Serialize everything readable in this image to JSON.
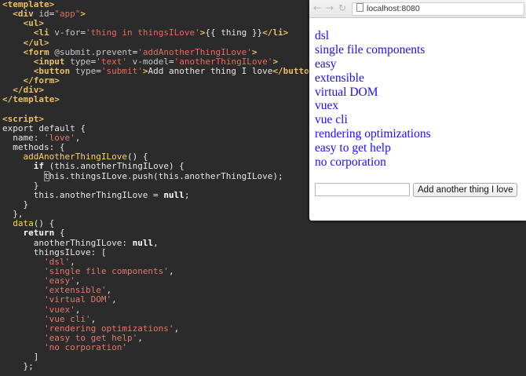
{
  "editor": {
    "lines": [
      [
        [
          "tag",
          "<template>"
        ]
      ],
      [
        [
          "plain",
          "  "
        ],
        [
          "tag",
          "<div "
        ],
        [
          "attr",
          "id"
        ],
        [
          "plain",
          "="
        ],
        [
          "str",
          "\"app\""
        ],
        [
          "tag",
          ">"
        ]
      ],
      [
        [
          "plain",
          "    "
        ],
        [
          "tag",
          "<ul>"
        ]
      ],
      [
        [
          "plain",
          "      "
        ],
        [
          "tag",
          "<li "
        ],
        [
          "attr",
          "v-for"
        ],
        [
          "plain",
          "="
        ],
        [
          "str",
          "'thing in thingsILove'"
        ],
        [
          "tag",
          ">"
        ],
        [
          "plain",
          "{{ thing }}"
        ],
        [
          "tag",
          "</li>"
        ]
      ],
      [
        [
          "plain",
          "    "
        ],
        [
          "tag",
          "</ul>"
        ]
      ],
      [
        [
          "plain",
          "    "
        ],
        [
          "tag",
          "<form "
        ],
        [
          "attr",
          "@submit.prevent"
        ],
        [
          "plain",
          "="
        ],
        [
          "str",
          "'addAnotherThingILove'"
        ],
        [
          "tag",
          ">"
        ]
      ],
      [
        [
          "plain",
          "      "
        ],
        [
          "tag",
          "<input "
        ],
        [
          "attr",
          "type"
        ],
        [
          "plain",
          "="
        ],
        [
          "str",
          "'text'"
        ],
        [
          "plain",
          " "
        ],
        [
          "attr",
          "v-model"
        ],
        [
          "plain",
          "="
        ],
        [
          "str",
          "'anotherThingILove'"
        ],
        [
          "tag",
          ">"
        ]
      ],
      [
        [
          "plain",
          "      "
        ],
        [
          "tag",
          "<button "
        ],
        [
          "attr",
          "type"
        ],
        [
          "plain",
          "="
        ],
        [
          "str",
          "'submit'"
        ],
        [
          "tag",
          ">"
        ],
        [
          "plain",
          "Add another thing I love"
        ],
        [
          "tag",
          "</button>"
        ]
      ],
      [
        [
          "plain",
          "    "
        ],
        [
          "tag",
          "</form>"
        ]
      ],
      [
        [
          "plain",
          "  "
        ],
        [
          "tag",
          "</div>"
        ]
      ],
      [
        [
          "tag",
          "</template>"
        ]
      ],
      [
        [
          "plain",
          ""
        ]
      ],
      [
        [
          "tag",
          "<script>"
        ]
      ],
      [
        [
          "plain",
          "export default {"
        ]
      ],
      [
        [
          "plain",
          "  name: "
        ],
        [
          "vstr",
          "'love'"
        ],
        [
          "plain",
          ","
        ]
      ],
      [
        [
          "plain",
          "  methods: {"
        ]
      ],
      [
        [
          "plain",
          "    "
        ],
        [
          "fn",
          "addAnotherThingILove"
        ],
        [
          "plain",
          "() {"
        ]
      ],
      [
        [
          "plain",
          "      "
        ],
        [
          "kw",
          "if"
        ],
        [
          "plain",
          " (this.anotherThingILove) {"
        ]
      ],
      [
        [
          "plain",
          "        "
        ],
        [
          "cursor",
          "t"
        ],
        [
          "plain",
          "his.thingsILove.push(this.anotherThingILove);"
        ]
      ],
      [
        [
          "plain",
          "      }"
        ]
      ],
      [
        [
          "plain",
          "      this.anotherThingILove = "
        ],
        [
          "kw",
          "null"
        ],
        [
          "plain",
          ";"
        ]
      ],
      [
        [
          "plain",
          "    }"
        ]
      ],
      [
        [
          "plain",
          "  },"
        ]
      ],
      [
        [
          "plain",
          "  "
        ],
        [
          "fn",
          "data"
        ],
        [
          "plain",
          "() {"
        ]
      ],
      [
        [
          "plain",
          "    "
        ],
        [
          "kw",
          "return"
        ],
        [
          "plain",
          " {"
        ]
      ],
      [
        [
          "plain",
          "      anotherThingILove: "
        ],
        [
          "kw",
          "null"
        ],
        [
          "plain",
          ","
        ]
      ],
      [
        [
          "plain",
          "      thingsILove: ["
        ]
      ],
      [
        [
          "plain",
          "        "
        ],
        [
          "vstr",
          "'dsl'"
        ],
        [
          "plain",
          ","
        ]
      ],
      [
        [
          "plain",
          "        "
        ],
        [
          "vstr",
          "'single file components'"
        ],
        [
          "plain",
          ","
        ]
      ],
      [
        [
          "plain",
          "        "
        ],
        [
          "vstr",
          "'easy'"
        ],
        [
          "plain",
          ","
        ]
      ],
      [
        [
          "plain",
          "        "
        ],
        [
          "vstr",
          "'extensible'"
        ],
        [
          "plain",
          ","
        ]
      ],
      [
        [
          "plain",
          "        "
        ],
        [
          "vstr",
          "'virtual DOM'"
        ],
        [
          "plain",
          ","
        ]
      ],
      [
        [
          "plain",
          "        "
        ],
        [
          "vstr",
          "'vuex'"
        ],
        [
          "plain",
          ","
        ]
      ],
      [
        [
          "plain",
          "        "
        ],
        [
          "vstr",
          "'vue cli'"
        ],
        [
          "plain",
          ","
        ]
      ],
      [
        [
          "plain",
          "        "
        ],
        [
          "vstr",
          "'rendering optimizations'"
        ],
        [
          "plain",
          ","
        ]
      ],
      [
        [
          "plain",
          "        "
        ],
        [
          "vstr",
          "'easy to get help'"
        ],
        [
          "plain",
          ","
        ]
      ],
      [
        [
          "plain",
          "        "
        ],
        [
          "vstr",
          "'no corporation'"
        ]
      ],
      [
        [
          "plain",
          "      ]"
        ]
      ],
      [
        [
          "plain",
          "    };"
        ]
      ]
    ]
  },
  "browser": {
    "back_icon": "back-arrow-icon",
    "forward_icon": "forward-arrow-icon",
    "refresh_icon": "refresh-icon",
    "url": "localhost:8080",
    "things": [
      "dsl",
      "single file components",
      "easy",
      "extensible",
      "virtual DOM",
      "vuex",
      "vue cli",
      "rendering optimizations",
      "easy to get help",
      "no corporation"
    ],
    "input_value": "",
    "button_label": "Add another thing I love"
  }
}
